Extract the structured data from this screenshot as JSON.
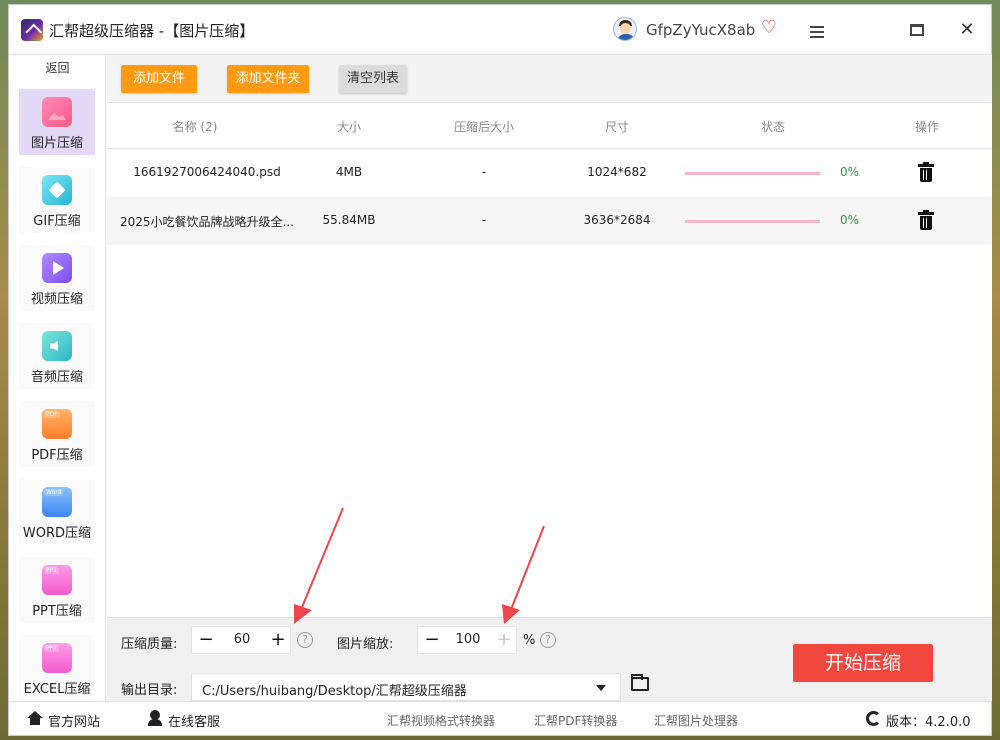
{
  "app": {
    "title": "汇帮超级压缩器",
    "subtitle": " -【图片压缩】",
    "user_name": "GfpZyYucX8ab"
  },
  "sidebar": {
    "back_label": "返回",
    "items": [
      {
        "label": "图片压缩",
        "icon": "image-icon",
        "active": true
      },
      {
        "label": "GIF压缩",
        "icon": "gif-icon"
      },
      {
        "label": "视频压缩",
        "icon": "video-icon"
      },
      {
        "label": "音频压缩",
        "icon": "audio-icon"
      },
      {
        "label": "PDF压缩",
        "icon": "pdf-icon",
        "tag": "PDF"
      },
      {
        "label": "WORD压缩",
        "icon": "word-icon",
        "tag": "Word"
      },
      {
        "label": "PPT压缩",
        "icon": "ppt-icon",
        "tag": "PPT"
      },
      {
        "label": "EXCEL压缩",
        "icon": "excel-icon",
        "tag": "PPT"
      }
    ]
  },
  "toolbar": {
    "add_file": "添加文件",
    "add_folder": "添加文件夹",
    "clear_list": "清空列表"
  },
  "table": {
    "headers": [
      "名称 (2)",
      "大小",
      "压缩后大小",
      "尺寸",
      "状态",
      "操作"
    ],
    "rows": [
      {
        "name": "1661927006424040.psd",
        "size": "4MB",
        "compressed": "-",
        "dimensions": "1024*682",
        "progress": "0%"
      },
      {
        "name": "2025小吃餐饮品牌战略升级全...",
        "size": "55.84MB",
        "compressed": "-",
        "dimensions": "3636*2684",
        "progress": "0%"
      }
    ]
  },
  "settings": {
    "quality_label": "压缩质量:",
    "quality_value": "60",
    "scale_label": "图片缩放:",
    "scale_value": "100",
    "scale_unit": "%",
    "output_label": "输出目录:",
    "output_path": "C:/Users/huibang/Desktop/汇帮超级压缩器",
    "start_button": "开始压缩"
  },
  "footer": {
    "website": "官方网站",
    "support": "在线客服",
    "links": [
      "汇帮视频格式转换器",
      "汇帮PDF转换器",
      "汇帮图片处理器"
    ],
    "version_label": "版本：",
    "version": "4.2.0.0"
  },
  "colors": {
    "accent_orange": "#ff9a12",
    "start_red": "#f2473e",
    "progress_green": "#2a9a3a",
    "active_sidebar": "#e3d9f7",
    "annotation_arrow": "#f0444c"
  }
}
